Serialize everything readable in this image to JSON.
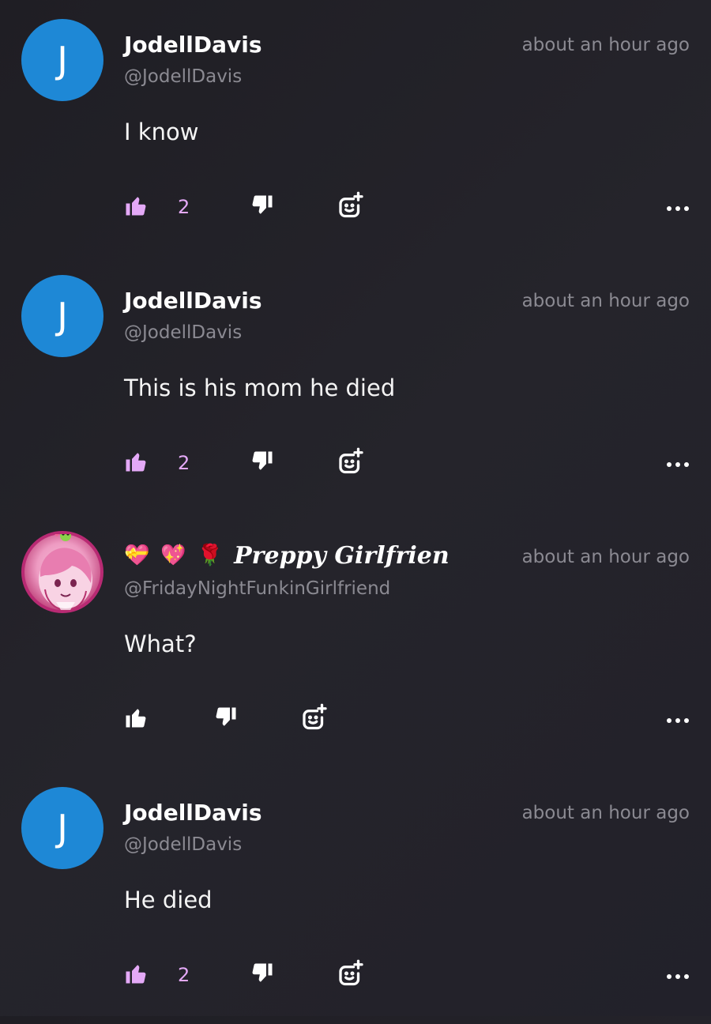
{
  "comments": [
    {
      "avatar_letter": "J",
      "name": "JodellDavis",
      "handle": "@JodellDavis",
      "time": "about an hour ago",
      "text": "I know",
      "likes": "2",
      "liked": true
    },
    {
      "avatar_letter": "J",
      "name": "JodellDavis",
      "handle": "@JodellDavis",
      "time": "about an hour ago",
      "text": "This is his mom he died",
      "likes": "2",
      "liked": true
    },
    {
      "avatar_letter": "",
      "name_emojis": [
        "💝",
        "💖",
        "🌹"
      ],
      "name": "Preppy Girlfrien",
      "handle": "@FridayNightFunkinGirlfriend",
      "time": "about an hour ago",
      "text": "What?",
      "likes": "",
      "liked": false
    },
    {
      "avatar_letter": "J",
      "name": "JodellDavis",
      "handle": "@JodellDavis",
      "time": "about an hour ago",
      "text": "He died",
      "likes": "2",
      "liked": true
    }
  ],
  "icons": {
    "like": "thumbs-up-icon",
    "dislike": "thumbs-down-icon",
    "react": "add-reaction-icon",
    "more": "more-options-icon"
  },
  "colors": {
    "background": "#23222a",
    "avatar_blue": "#1e88d6",
    "liked_accent": "#e4a9f7",
    "muted_text": "#8b8a92"
  }
}
